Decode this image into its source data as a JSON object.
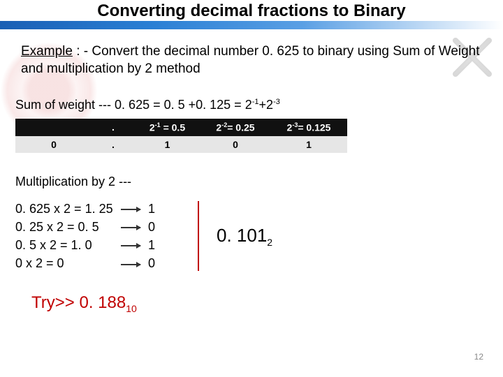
{
  "title": "Converting decimal fractions to Binary",
  "example": {
    "label": "Example",
    "text_after_label": " : - Convert the decimal number 0. 625 to binary using Sum of Weight and multiplication by 2 method"
  },
  "sum_of_weight": {
    "prefix": "Sum of weight --- 0. 625 = 0. 5 +0. 125 = 2",
    "exp1": "-1",
    "mid": "+2",
    "exp2": "-3"
  },
  "table": {
    "header": {
      "c0": "",
      "c1": ".",
      "c2_pre": "2",
      "c2_sup": "-1",
      "c2_post": " = 0.5",
      "c3_pre": "2",
      "c3_sup": "-2",
      "c3_post": "= 0.25",
      "c4_pre": "2",
      "c4_sup": "-3",
      "c4_post": "= 0.125"
    },
    "values": {
      "c0": "0",
      "c1": ".",
      "c2": "1",
      "c3": "0",
      "c4": "1"
    }
  },
  "mult": {
    "heading": "Multiplication by 2 ---",
    "rows": [
      {
        "eq": "0. 625 x 2 = 1. 25",
        "bit": "1"
      },
      {
        "eq": "0. 25 x 2 = 0. 5",
        "bit": "0"
      },
      {
        "eq": "0. 5 x 2 = 1. 0",
        "bit": "1"
      },
      {
        "eq": "0 x 2 = 0",
        "bit": "0"
      }
    ]
  },
  "result": {
    "value": "0. 101",
    "base": "2"
  },
  "try": {
    "prefix": "Try>> ",
    "value": "0. 188",
    "base": "10"
  },
  "page": "12"
}
